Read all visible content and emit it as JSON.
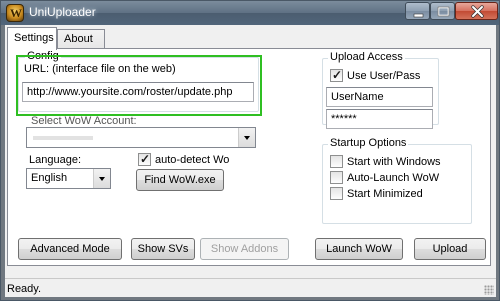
{
  "window": {
    "title": "UniUploader"
  },
  "tabs": [
    {
      "label": "Settings",
      "active": true
    },
    {
      "label": "About",
      "active": false
    }
  ],
  "config": {
    "legend": "Config",
    "url_label": "URL: (interface file on the web)",
    "url_value": "http://www.yoursite.com/roster/update.php"
  },
  "wow_account": {
    "label": "Select WoW Account:",
    "value": ""
  },
  "language": {
    "label": "Language:",
    "selected": "English",
    "autodetect_label": "auto-detect Wo",
    "autodetect_checked": true,
    "find_button": "Find WoW.exe"
  },
  "upload_access": {
    "legend": "Upload Access",
    "use_userpass_label": "Use User/Pass",
    "use_userpass_checked": true,
    "username_value": "UserName",
    "password_value": "******"
  },
  "startup_options": {
    "legend": "Startup Options",
    "items": [
      {
        "label": "Start with Windows",
        "checked": false
      },
      {
        "label": "Auto-Launch WoW",
        "checked": false
      },
      {
        "label": "Start Minimized",
        "checked": false
      }
    ]
  },
  "buttons": {
    "advanced_mode": "Advanced Mode",
    "show_svs": "Show SVs",
    "show_addons": "Show Addons",
    "launch_wow": "Launch WoW",
    "upload": "Upload"
  },
  "status": {
    "text": "Ready."
  }
}
